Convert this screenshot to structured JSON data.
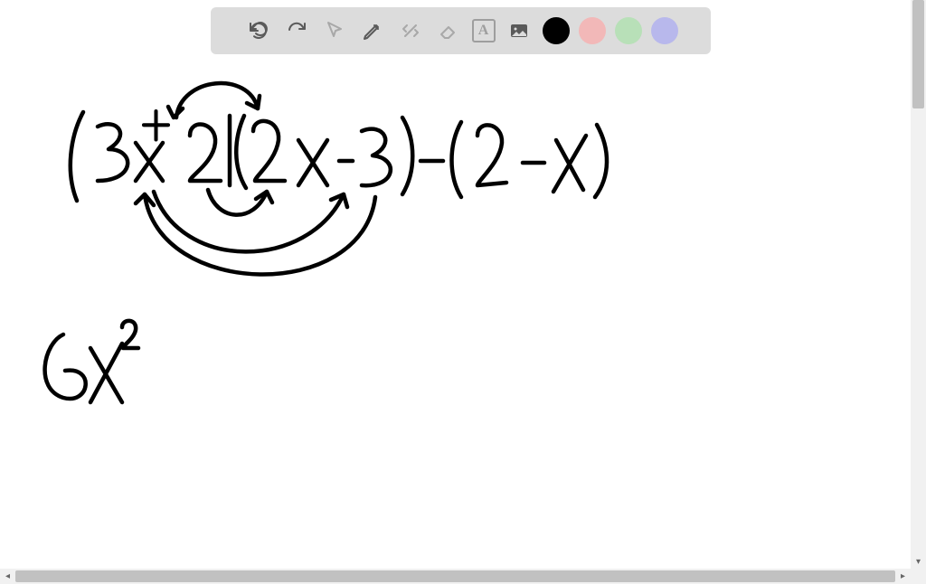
{
  "toolbar": {
    "undo": "undo",
    "redo": "redo",
    "pointer": "pointer",
    "pencil": "pencil",
    "tools": "tools",
    "eraser": "eraser",
    "text_label": "A",
    "image": "image",
    "colors": {
      "black": "#000000",
      "pink": "#f2b8b8",
      "green": "#b8e0b8",
      "purple": "#b8b8ec"
    }
  },
  "handwriting": {
    "line1": "(3x+2)(2x-3)-(2-x)",
    "line2": "6x²",
    "annotations": "FOIL arrows connecting terms of (3x+2)(2x-3)"
  }
}
